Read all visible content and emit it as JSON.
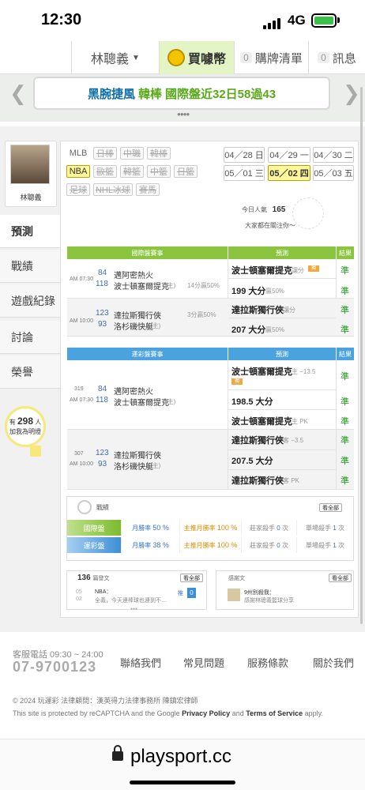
{
  "status": {
    "time": "12:30",
    "network": "4G"
  },
  "nav": {
    "user": "林聰義",
    "coin": "買噱幣",
    "cart_count": "0",
    "cart": "購牌清單",
    "msg_count": "0",
    "msg": "訊息"
  },
  "banner": {
    "prefix": "黑腕捷風",
    "middle": "韓棒",
    "highlight": "國際盤近32日58過43"
  },
  "profile": {
    "name": "林聰義"
  },
  "sidebar": {
    "items": [
      "預測",
      "戰績",
      "遊戲紀錄",
      "討論",
      "榮譽"
    ],
    "fans_prefix": "有",
    "fans_count": "298",
    "fans_unit": "人",
    "fans_caption": "加我為明燈"
  },
  "leagues": {
    "row1": [
      "MLB",
      "日棒",
      "中職",
      "韓棒"
    ],
    "row2": [
      "NBA",
      "歐籃",
      "韓籃",
      "中籃",
      "日籃"
    ],
    "row3": [
      "足球",
      "NHL冰球",
      "賽馬"
    ]
  },
  "dates": [
    [
      "04／28",
      "日"
    ],
    [
      "04／29",
      "一"
    ],
    [
      "04／30",
      "二"
    ],
    [
      "05／01",
      "三"
    ],
    [
      "05／02",
      "四"
    ],
    [
      "05／03",
      "五"
    ]
  ],
  "popularity": {
    "label": "今日人氣",
    "count": "165",
    "sub": "大家都在關注你～"
  },
  "intl": {
    "header": "國際盤賽事",
    "pick_header": "預測",
    "result_header": "結果",
    "games": [
      {
        "time": "AM 07:30",
        "num1": "84",
        "team1": "邁阿密熱火",
        "num2": "118",
        "team2": "波士頓塞爾提克",
        "home": "(主)",
        "line": "14分贏50%",
        "pick1": "波士頓塞爾提克",
        "pick1_note": "讓分",
        "pick1_badge": "獨",
        "res1": "準",
        "pick2": "199 大分",
        "pick2_note": "贏50%",
        "res2": "準"
      },
      {
        "time": "AM 10:00",
        "num1": "123",
        "team1": "達拉斯獨行俠",
        "num2": "93",
        "team2": "洛杉磯快艇",
        "home": "(主)",
        "line": "3分贏50%",
        "pick1": "達拉斯獨行俠",
        "pick1_note": "讓分",
        "pick1_badge": "",
        "res1": "準",
        "pick2": "207 大分",
        "pick2_note": "贏50%",
        "res2": "準"
      }
    ]
  },
  "lottery": {
    "header": "運彩盤賽事",
    "pick_header": "預測",
    "result_header": "結果",
    "games": [
      {
        "code": "319",
        "time": "AM 07:30",
        "num1": "84",
        "team1": "邁阿密熱火",
        "num2": "118",
        "team2": "波士頓塞爾提克",
        "home": "(主)",
        "picks": [
          {
            "text": "波士頓塞爾提克",
            "note": "主 −13.5",
            "badge": "獨",
            "res": "準"
          },
          {
            "text": "198.5 大分",
            "note": "",
            "badge": "",
            "res": "準"
          },
          {
            "text": "波士頓塞爾提克",
            "note": "主 PK",
            "badge": "",
            "res": "準"
          }
        ]
      },
      {
        "code": "307",
        "time": "AM 10:00",
        "num1": "123",
        "team1": "達拉斯獨行俠",
        "num2": "93",
        "team2": "洛杉磯快艇",
        "home": "(主)",
        "picks": [
          {
            "text": "達拉斯獨行俠",
            "note": "客 −3.5",
            "badge": "",
            "res": "準"
          },
          {
            "text": "207.5 大分",
            "note": "",
            "badge": "",
            "res": "準"
          },
          {
            "text": "達拉斯獨行俠",
            "note": "客 PK",
            "badge": "",
            "res": "準"
          }
        ]
      }
    ]
  },
  "record": {
    "title": "戰績",
    "view_all": "看全部",
    "rows": [
      {
        "label": "國際盤",
        "month": "月勝率",
        "month_val": "50 %",
        "main": "主推月勝率",
        "main_val": "100 %",
        "kill": "莊家殺手",
        "kill_val": "0",
        "kill_unit": "次",
        "single": "單場殺手",
        "single_val": "1",
        "single_unit": "次"
      },
      {
        "label": "運彩盤",
        "month": "月勝率",
        "month_val": "38 %",
        "main": "主推月勝率",
        "main_val": "100 %",
        "kill": "莊家殺手",
        "kill_val": "0",
        "kill_unit": "次",
        "single": "單場殺手",
        "single_val": "1",
        "single_unit": "次"
      }
    ]
  },
  "posts": {
    "count": "136",
    "title": "篇發文",
    "view_all": "看全部",
    "date_top": "05",
    "date_bottom": "02",
    "category": "NBA：",
    "preview": "全義，今天連棒球也連到不…",
    "tag": "推",
    "likes": "0"
  },
  "thanks": {
    "title": "感謝文",
    "view_all": "看全部",
    "author": "9州別殺我：",
    "text": "感謝林聰義籃球分享"
  },
  "footer": {
    "tel_label": "客服電話 09:30 ~ 24:00",
    "tel": "07-9700123",
    "links": [
      "聯絡我們",
      "常見問題",
      "服務條款",
      "關於我們"
    ],
    "copyright": "© 2024 玩運彩 法律顧問：漢英得力法律事務所 陳鎮宏律師",
    "recaptcha_prefix": "This site is protected by reCAPTCHA and the Google",
    "privacy": "Privacy Policy",
    "and": "and",
    "terms": "Terms of Service",
    "apply": "apply."
  },
  "browser": {
    "url": "playsport.cc"
  },
  "colors": {
    "green": "#8bc43f",
    "blue": "#4aa3df",
    "highlight": "#fff799",
    "link": "#0e6fa6"
  }
}
